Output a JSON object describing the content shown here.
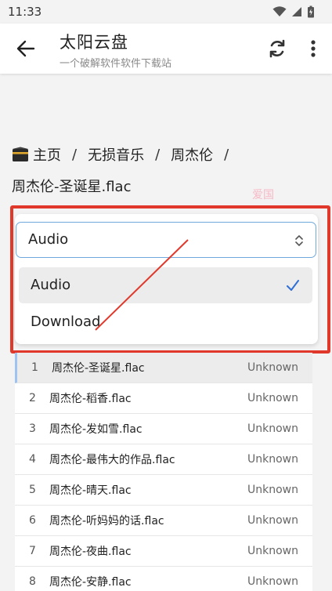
{
  "status_bar": {
    "time": "11:33"
  },
  "app_bar": {
    "title": "太阳云盘",
    "subtitle": "一个破解软件软件下载站"
  },
  "breadcrumb": {
    "items": [
      "主页",
      "无损音乐",
      "周杰伦"
    ],
    "separator": "/"
  },
  "file_title": "周杰伦-圣诞星.flac",
  "watermark": "爱国",
  "select": {
    "value": "Audio",
    "options": [
      {
        "label": "Audio",
        "selected": true
      },
      {
        "label": "Download",
        "selected": false
      }
    ]
  },
  "files": [
    {
      "num": "1",
      "name": "周杰伦-圣诞星.flac",
      "size": "Unknown"
    },
    {
      "num": "2",
      "name": "周杰伦-稻香.flac",
      "size": "Unknown"
    },
    {
      "num": "3",
      "name": "周杰伦-发如雪.flac",
      "size": "Unknown"
    },
    {
      "num": "4",
      "name": "周杰伦-最伟大的作品.flac",
      "size": "Unknown"
    },
    {
      "num": "5",
      "name": "周杰伦-晴天.flac",
      "size": "Unknown"
    },
    {
      "num": "6",
      "name": "周杰伦-听妈妈的话.flac",
      "size": "Unknown"
    },
    {
      "num": "7",
      "name": "周杰伦-夜曲.flac",
      "size": "Unknown"
    },
    {
      "num": "8",
      "name": "周杰伦-安静.flac",
      "size": "Unknown"
    }
  ],
  "colors": {
    "annotation": "#e0392b",
    "focus_border": "#6fa8dc",
    "check": "#2f6fd6"
  }
}
